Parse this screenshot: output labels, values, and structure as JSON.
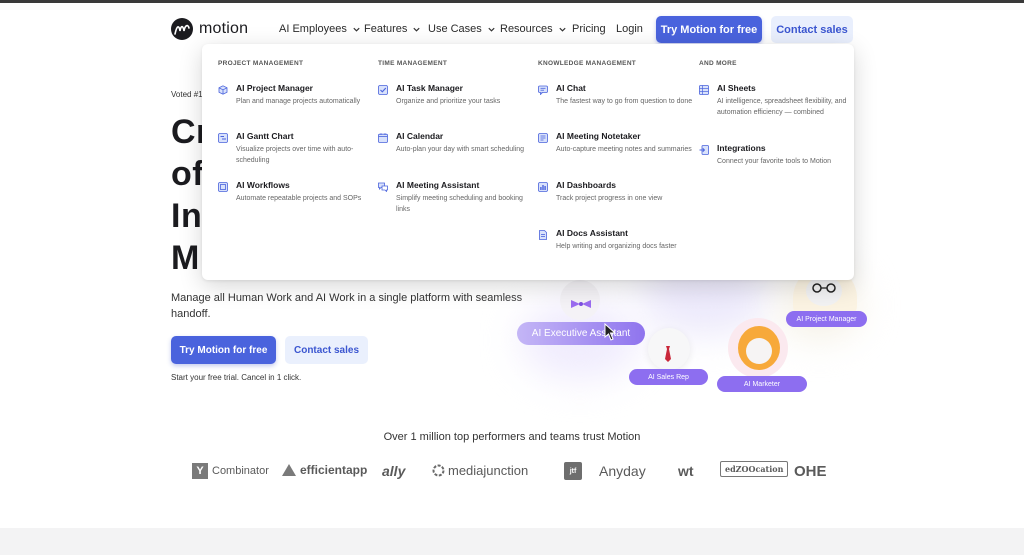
{
  "nav": {
    "brand": "motion",
    "items": [
      {
        "label": "AI Employees",
        "has_chevron": true
      },
      {
        "label": "Features",
        "has_chevron": true
      },
      {
        "label": "Use Cases",
        "has_chevron": true
      },
      {
        "label": "Resources",
        "has_chevron": true
      },
      {
        "label": "Pricing",
        "has_chevron": false
      },
      {
        "label": "Login",
        "has_chevron": false
      }
    ],
    "cta_primary": "Try Motion for free",
    "cta_secondary": "Contact sales"
  },
  "dropdown": {
    "columns": [
      {
        "heading": "PROJECT MANAGEMENT",
        "entries": [
          {
            "title": "AI Project Manager",
            "desc": "Plan and manage projects automatically",
            "icon": "cube-icon"
          },
          {
            "title": "AI Gantt Chart",
            "desc": "Visualize projects over time with auto-scheduling",
            "icon": "gantt-icon"
          },
          {
            "title": "AI Workflows",
            "desc": "Automate repeatable projects and SOPs",
            "icon": "workflow-icon"
          }
        ]
      },
      {
        "heading": "TIME MANAGEMENT",
        "entries": [
          {
            "title": "AI Task Manager",
            "desc": "Organize and prioritize your tasks",
            "icon": "task-check-icon"
          },
          {
            "title": "AI Calendar",
            "desc": "Auto-plan your day with smart scheduling",
            "icon": "calendar-icon"
          },
          {
            "title": "AI Meeting Assistant",
            "desc": "Simplify meeting scheduling and booking links",
            "icon": "chat-bubbles-icon"
          }
        ]
      },
      {
        "heading": "KNOWLEDGE MANAGEMENT",
        "entries": [
          {
            "title": "AI Chat",
            "desc": "The fastest way to go from question to done",
            "icon": "chat-icon"
          },
          {
            "title": "AI Meeting Notetaker",
            "desc": "Auto-capture meeting notes and summaries",
            "icon": "notetaker-icon"
          },
          {
            "title": "AI Dashboards",
            "desc": "Track project progress in one view",
            "icon": "dashboard-icon"
          },
          {
            "title": "AI Docs Assistant",
            "desc": "Help writing and organizing docs faster",
            "icon": "document-icon"
          }
        ]
      },
      {
        "heading": "AND MORE",
        "entries": [
          {
            "title": "AI Sheets",
            "desc": "AI intelligence, spreadsheet flexibility, and automation efficiency — combined",
            "icon": "sheet-icon"
          },
          {
            "title": "Integrations",
            "desc": "Connect your favorite tools to Motion",
            "icon": "integrations-icon"
          }
        ]
      }
    ]
  },
  "hero": {
    "voted": "Voted #1",
    "headline_visible": [
      "Cr",
      "of",
      "In",
      "M"
    ],
    "subtitle": "Manage all Human Work and AI Work in a single platform with seamless handoff.",
    "cta_primary": "Try Motion for free",
    "cta_secondary": "Contact sales",
    "trial_note": "Start your free trial. Cancel in 1 click."
  },
  "illustration": {
    "labels": {
      "executive": "AI Executive Assistant",
      "project_manager": "AI Project Manager",
      "sales_rep": "AI Sales Rep",
      "marketer": "AI Marketer"
    }
  },
  "trust": {
    "title": "Over 1 million top performers and teams trust Motion",
    "logos": [
      "Y",
      "Combinator",
      "efficientapp",
      "ally",
      "mediajunction",
      "jtf",
      "Anyday",
      "wt",
      "edZOOcation",
      "OHE"
    ]
  },
  "colors": {
    "primary": "#4a63dd",
    "secondary_bg": "#e9effd",
    "purple_pill": "#7c5ce8"
  }
}
